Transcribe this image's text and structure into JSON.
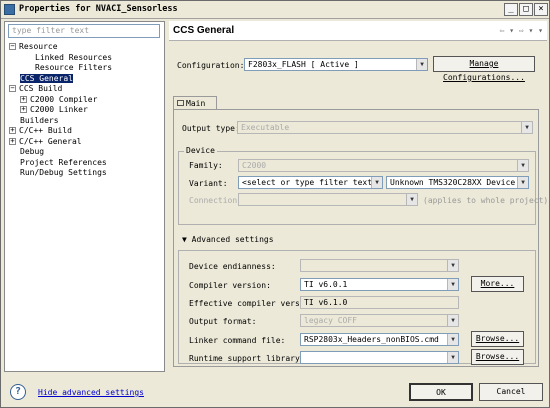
{
  "window": {
    "title": "Properties for NVACI_Sensorless",
    "minimize": "_",
    "maximize": "□",
    "close": "×"
  },
  "left": {
    "filter_placeholder": "type filter text",
    "tree": [
      {
        "label": "Resource",
        "expander": "−",
        "level": 0
      },
      {
        "label": "Linked Resources",
        "expander": "",
        "level": 2
      },
      {
        "label": "Resource Filters",
        "expander": "",
        "level": 2
      },
      {
        "label": "CCS General",
        "expander": "",
        "level": 1,
        "selected": true
      },
      {
        "label": "CCS Build",
        "expander": "−",
        "level": 0
      },
      {
        "label": "C2000 Compiler",
        "expander": "+",
        "level": 1
      },
      {
        "label": "C2000 Linker",
        "expander": "+",
        "level": 1
      },
      {
        "label": "Builders",
        "expander": "",
        "level": 1
      },
      {
        "label": "C/C++ Build",
        "expander": "+",
        "level": 0
      },
      {
        "label": "C/C++ General",
        "expander": "+",
        "level": 0
      },
      {
        "label": "Debug",
        "expander": "",
        "level": 1
      },
      {
        "label": "Project References",
        "expander": "",
        "level": 1
      },
      {
        "label": "Run/Debug Settings",
        "expander": "",
        "level": 1
      }
    ]
  },
  "header": {
    "title": "CCS General",
    "nav": "⇦ ▾ ⇨ ▾ ▾"
  },
  "config": {
    "label": "Configuration:",
    "value": "F2803x_FLASH  [ Active ]",
    "manage_button": "Manage Configurations..."
  },
  "tab": {
    "label": "Main"
  },
  "output_type": {
    "label": "Output type:",
    "value": "Executable"
  },
  "device": {
    "group_title": "Device",
    "family_label": "Family:",
    "family_value": "C2000",
    "variant_label": "Variant:",
    "variant_filter": "<select or type filter text>",
    "variant_value": "Unknown TMS320C28XX Device",
    "connection_label": "Connection:",
    "connection_value": "",
    "connection_note": "(applies to whole project)"
  },
  "advanced": {
    "title": "Advanced settings",
    "endianness_label": "Device endianness:",
    "endianness_value": "",
    "compiler_label": "Compiler version:",
    "compiler_value": "TI v6.0.1",
    "more_button": "More...",
    "effective_label": "Effective compiler version:",
    "effective_value": "TI v6.1.0",
    "output_format_label": "Output format:",
    "output_format_value": "legacy COFF",
    "linker_label": "Linker command file:",
    "linker_value": "RSP2803x_Headers_nonBIOS.cmd",
    "browse_button": "Browse...",
    "runtime_label": "Runtime support library:",
    "runtime_value": "",
    "browse_button2": "Browse..."
  },
  "footer": {
    "help": "?",
    "hide_link": "Hide advanced settings",
    "ok": "OK",
    "cancel": "Cancel"
  }
}
